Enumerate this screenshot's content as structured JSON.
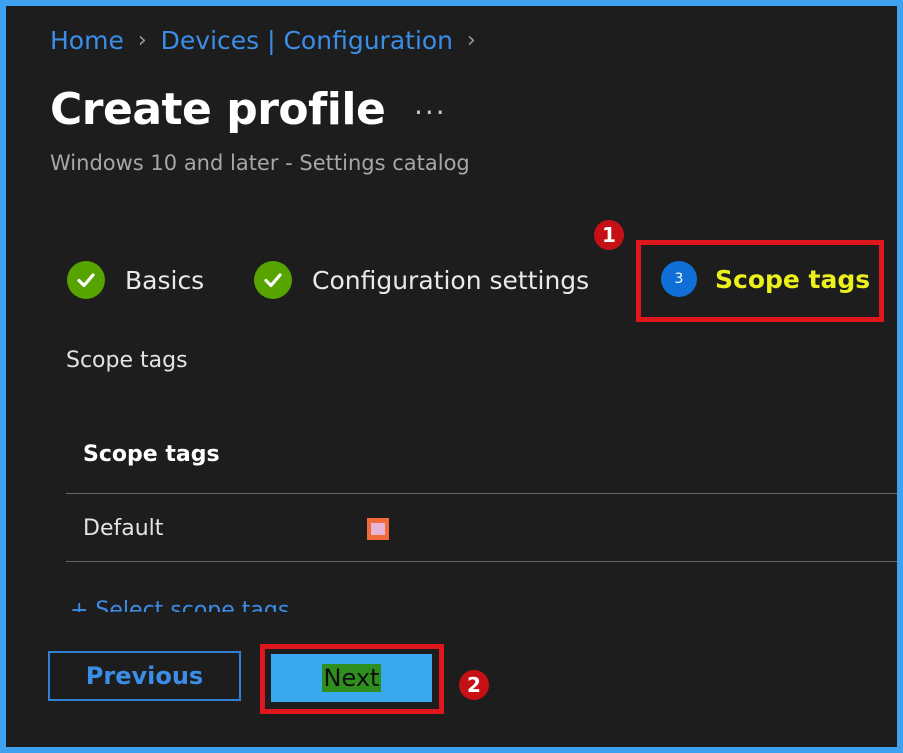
{
  "breadcrumb": {
    "home": "Home",
    "devices": "Devices | Configuration"
  },
  "header": {
    "title": "Create profile",
    "more": "···",
    "subtitle": "Windows 10 and later - Settings catalog"
  },
  "steps": [
    {
      "label": "Basics",
      "status": "complete"
    },
    {
      "label": "Configuration settings",
      "status": "complete"
    },
    {
      "number": "3",
      "label": "Scope tags",
      "status": "current"
    }
  ],
  "annotations": {
    "marker1": "1",
    "marker2": "2"
  },
  "scope": {
    "section_label": "Scope tags",
    "column_header": "Scope tags",
    "rows": [
      {
        "name": "Default"
      }
    ],
    "add_link": "+ Select scope tags"
  },
  "footer": {
    "previous": "Previous",
    "next": "Next"
  },
  "colors": {
    "accent": "#3b8ee8",
    "complete": "#57a300",
    "current_step": "#0f6fd6",
    "highlight": "#ecf01b",
    "annotation_red": "#e0161f",
    "frame_border": "#3ea1ef",
    "background": "#1d1d1d"
  },
  "icons": {
    "breadcrumb_separator": "chevron-right-icon",
    "complete_step": "checkmark-icon",
    "row_logo": "logo-icon"
  }
}
